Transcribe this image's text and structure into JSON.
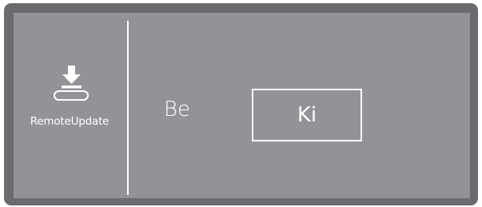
{
  "sidebar": {
    "remote_update": {
      "label": "RemoteUpdate",
      "icon": "download-tray-icon"
    }
  },
  "main": {
    "options": [
      {
        "label": "Be",
        "selected": false
      },
      {
        "label": "Ki",
        "selected": true
      }
    ]
  },
  "colors": {
    "frame": "#6a6b6e",
    "screen": "#929396",
    "foreground": "#ffffff"
  }
}
